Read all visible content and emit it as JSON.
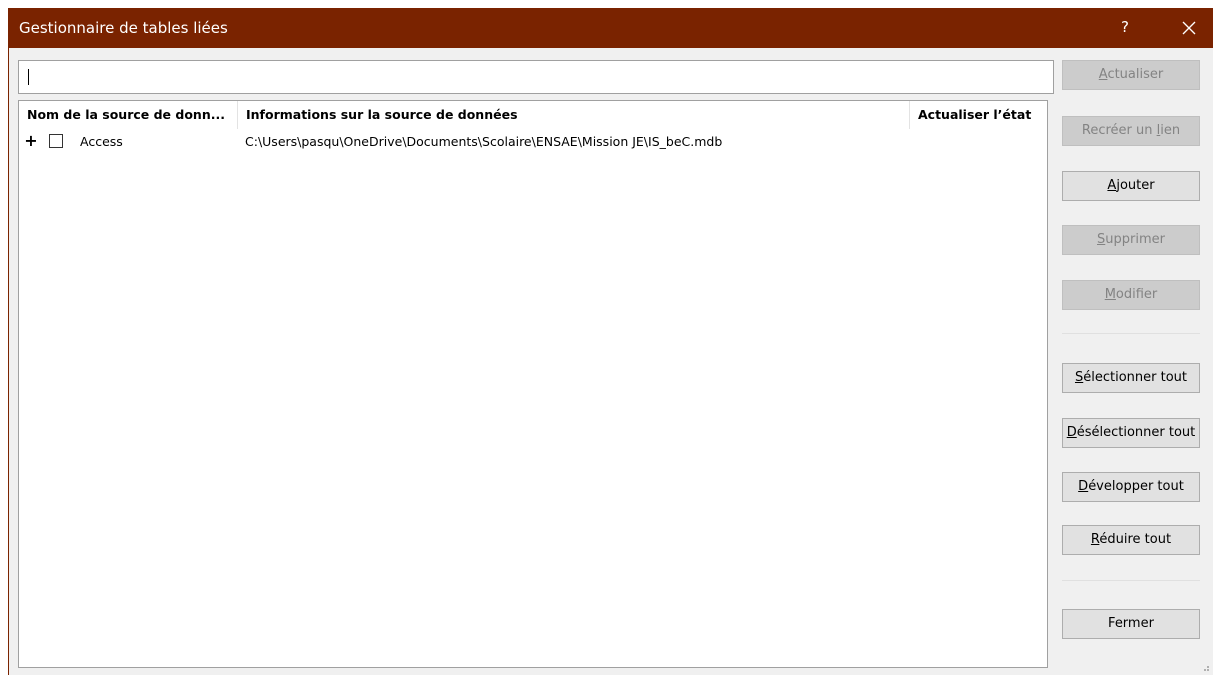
{
  "window": {
    "title": "Gestionnaire de tables liées",
    "help_label": "?"
  },
  "search": {
    "value": "",
    "placeholder": ""
  },
  "table": {
    "columns": [
      "Nom de la source de donn...",
      "Informations sur la source de données",
      "Actualiser l’état"
    ],
    "rows": [
      {
        "expander": "+",
        "checked": false,
        "name": "Access",
        "info": "C:\\Users\\pasqu\\OneDrive\\Documents\\Scolaire\\ENSAE\\Mission JE\\IS_beC.mdb",
        "status": ""
      }
    ]
  },
  "buttons": {
    "actualiser": {
      "pre": "",
      "key": "A",
      "post": "ctualiser",
      "enabled": false
    },
    "recreer": {
      "pre": "Recréer un ",
      "key": "l",
      "post": "ien",
      "enabled": false
    },
    "ajouter": {
      "pre": "",
      "key": "A",
      "post": "jouter",
      "enabled": true
    },
    "supprimer": {
      "pre": "",
      "key": "S",
      "post": "upprimer",
      "enabled": false
    },
    "modifier": {
      "pre": "",
      "key": "M",
      "post": "odifier",
      "enabled": false
    },
    "selectionner": {
      "pre": "",
      "key": "S",
      "post": "électionner tout",
      "enabled": true
    },
    "deselectionner": {
      "pre": "",
      "key": "D",
      "post": "ésélectionner tout",
      "enabled": true
    },
    "developper": {
      "pre": "",
      "key": "D",
      "post": "évelopper tout",
      "enabled": true
    },
    "reduire": {
      "pre": "",
      "key": "R",
      "post": "éduire tout",
      "enabled": true
    },
    "fermer": {
      "label": "Fermer",
      "enabled": true
    }
  },
  "colors": {
    "titlebar": "#7a2300",
    "dialog_bg": "#f0f0f0",
    "button_bg": "#e1e1e1",
    "button_disabled_bg": "#cccccc",
    "disabled_text": "#838383"
  },
  "icons": {
    "close": "close-icon",
    "expand": "plus-icon",
    "resize": "resize-grip-icon"
  }
}
